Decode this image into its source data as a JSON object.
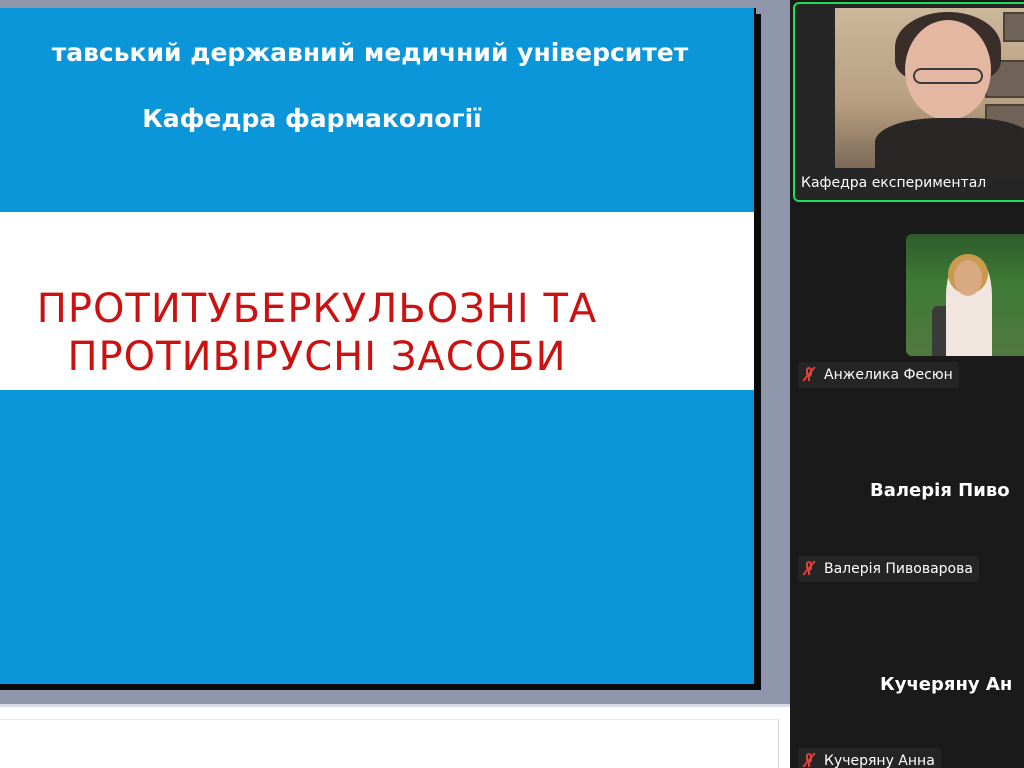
{
  "slide": {
    "university": "тавський державний медичний університет",
    "department": "Кафедра фармакології",
    "title_line1": "ПРОТИТУБЕРКУЛЬОЗНІ ТА",
    "title_line2": "ПРОТИВІРУСНІ ЗАСОБИ"
  },
  "participants": [
    {
      "name": "Кафедра експериментал",
      "video": true,
      "active_speaker": true
    },
    {
      "name": "Анжелика Фесюн",
      "video": true,
      "muted": true
    },
    {
      "display_name": "Валерія Пиво",
      "name": "Валерія Пивоварова",
      "video": false,
      "muted": true
    },
    {
      "display_name": "Кучеряну Ан",
      "name": "Кучеряну Анна",
      "video": false,
      "muted": true
    }
  ],
  "colors": {
    "slide_bg": "#0a96d9",
    "title_red": "#cc1111",
    "active_border": "#23d959",
    "muted_icon": "#e0413a"
  },
  "icons": [
    "mic-muted-icon"
  ]
}
